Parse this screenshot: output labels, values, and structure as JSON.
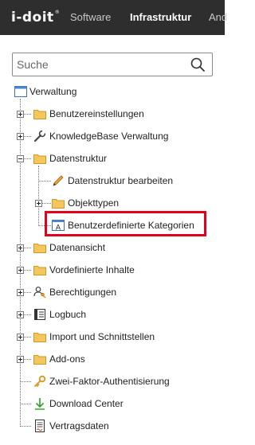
{
  "header": {
    "logo": "i-doit",
    "logo_mark": "®",
    "nav": [
      {
        "label": "Software",
        "active": false
      },
      {
        "label": "Infrastruktur",
        "active": true
      },
      {
        "label": "And",
        "active": false
      }
    ]
  },
  "search": {
    "placeholder": "Suche",
    "value": ""
  },
  "tree": {
    "root": {
      "label": "Verwaltung",
      "icon": "window-icon"
    },
    "items": [
      {
        "label": "Benutzereinstellungen",
        "icon": "folder-icon"
      },
      {
        "label": "KnowledgeBase Verwaltung",
        "icon": "wrench-icon"
      },
      {
        "label": "Datenstruktur",
        "icon": "folder-icon",
        "expanded": true,
        "children": [
          {
            "label": "Datenstruktur bearbeiten",
            "icon": "pencil-icon"
          },
          {
            "label": "Objekttypen",
            "icon": "folder-icon"
          },
          {
            "label": "Benutzerdefinierte Kategorien",
            "icon": "text-field-icon",
            "highlighted": true
          }
        ]
      },
      {
        "label": "Datenansicht",
        "icon": "folder-icon"
      },
      {
        "label": "Vordefinierte Inhalte",
        "icon": "folder-icon"
      },
      {
        "label": "Berechtigungen",
        "icon": "users-key-icon"
      },
      {
        "label": "Logbuch",
        "icon": "book-icon"
      },
      {
        "label": "Import und Schnittstellen",
        "icon": "folder-icon"
      },
      {
        "label": "Add-ons",
        "icon": "folder-icon"
      },
      {
        "label": "Zwei-Faktor-Authentisierung",
        "icon": "key-icon"
      },
      {
        "label": "Download Center",
        "icon": "download-arrow-icon"
      },
      {
        "label": "Vertragsdaten",
        "icon": "contract-document-icon"
      }
    ]
  },
  "colors": {
    "topbar": "#2e2e2e",
    "highlight": "#e3001b",
    "folder": "#f5c65b"
  }
}
